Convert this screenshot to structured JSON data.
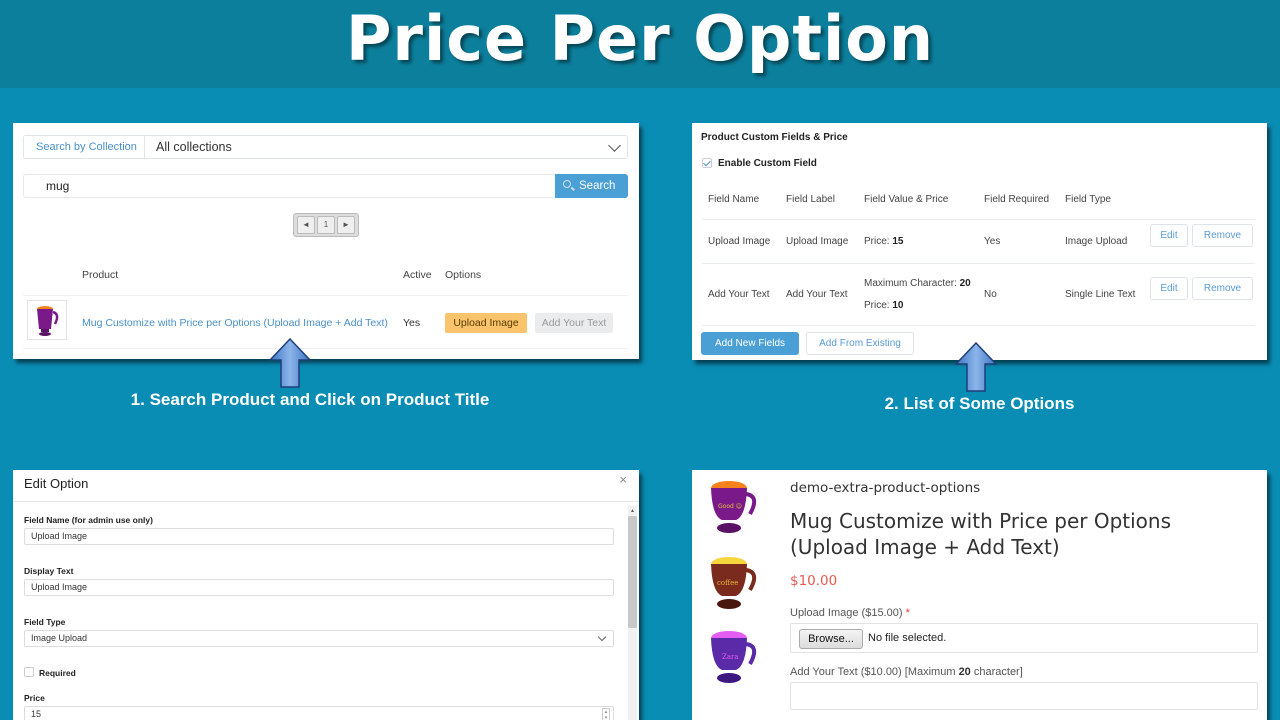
{
  "header": {
    "title": "Price Per Option"
  },
  "colors": {
    "background": "#0a8db5",
    "header_bg": "#0c7f9c",
    "accent_blue": "#4a9fd5",
    "upload_btn": "#f9c46b",
    "price_red": "#e55a4f"
  },
  "step1": {
    "caption": "1. Search Product and Click on Product Title",
    "collection_label": "Search by Collection",
    "collection_value": "All collections",
    "search_value": "mug",
    "search_button": "Search",
    "pager": {
      "prev": "◄",
      "page": "1",
      "next": "►"
    },
    "table": {
      "headers": [
        "Product",
        "Active",
        "Options"
      ],
      "rows": [
        {
          "product": "Mug Customize with Price per Options (Upload Image + Add Text)",
          "active": "Yes",
          "options": [
            "Upload Image",
            "Add Your Text"
          ]
        }
      ]
    }
  },
  "step2": {
    "caption": "2. List of Some Options",
    "title": "Product Custom Fields & Price",
    "enable_label": "Enable Custom Field",
    "enable_checked": true,
    "headers": [
      "Field Name",
      "Field Label",
      "Field Value & Price",
      "Field Required",
      "Field Type"
    ],
    "rows": [
      {
        "name": "Upload Image",
        "label": "Upload Image",
        "value_line1": "Price: ",
        "value_line1_bold": "15",
        "value_line2": "",
        "value_line2_bold": "",
        "required": "Yes",
        "type": "Image Upload"
      },
      {
        "name": "Add Your Text",
        "label": "Add Your Text",
        "value_line1": "Maximum Character: ",
        "value_line1_bold": "20",
        "value_line2": "Price: ",
        "value_line2_bold": "10",
        "required": "No",
        "type": "Single Line Text"
      }
    ],
    "edit_label": "Edit",
    "remove_label": "Remove",
    "add_new_label": "Add New Fields",
    "add_existing_label": "Add From Existing"
  },
  "step3": {
    "title": "Edit Option",
    "close": "×",
    "field_name_label": "Field Name (for admin use only)",
    "field_name_value": "Upload Image",
    "display_text_label": "Display Text",
    "display_text_value": "Upload Image",
    "field_type_label": "Field Type",
    "field_type_value": "Image Upload",
    "required_label": "Required",
    "required_checked": false,
    "price_label": "Price",
    "price_value": "15"
  },
  "step4": {
    "store_name": "demo-extra-product-options",
    "product_title": "Mug Customize with Price per Options (Upload Image + Add Text)",
    "price": "$10.00",
    "upload_label": "Upload Image ($15.00)",
    "required_mark": "*",
    "browse_label": "Browse...",
    "no_file": "No file selected.",
    "text_label_pre": "Add Your Text ($10.00) [Maximum ",
    "text_label_bold": "20",
    "text_label_post": " character]",
    "text_value": ""
  }
}
